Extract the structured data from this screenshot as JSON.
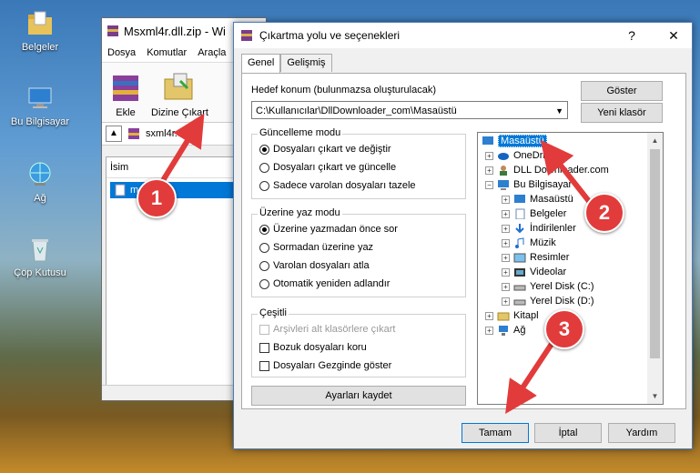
{
  "desktop": {
    "icons": [
      {
        "label": "Belgeler"
      },
      {
        "label": "Bu Bilgisayar"
      },
      {
        "label": "Ağ"
      },
      {
        "label": "Çöp Kutusu"
      }
    ]
  },
  "bg_window": {
    "title": "Msxml4r.dll.zip - Wi",
    "menu": [
      "Dosya",
      "Komutlar",
      "Araçla"
    ],
    "toolbar": {
      "add_label": "Ekle",
      "extract_label": "Dizine Çıkart"
    },
    "address": "sxml4r.dll",
    "column_name": "İsim",
    "file_item": "m          r.dll"
  },
  "dialog": {
    "title": "Çıkartma yolu ve seçenekleri",
    "help_glyph": "?",
    "close_glyph": "✕",
    "tabs": [
      "Genel",
      "Gelişmiş"
    ],
    "dest_label": "Hedef konum (bulunmazsa oluşturulacak)",
    "dest_value": "C:\\Kullanıcılar\\DllDownloader_com\\Masaüstü",
    "show_btn": "Göster",
    "new_folder_btn": "Yeni klasör",
    "update_group": {
      "title": "Güncelleme modu",
      "options": [
        "Dosyaları çıkart ve değiştir",
        "Dosyaları çıkart ve güncelle",
        "Sadece varolan dosyaları tazele"
      ],
      "selected": 0
    },
    "overwrite_group": {
      "title": "Üzerine yaz modu",
      "options": [
        "Üzerine yazmadan önce sor",
        "Sormadan üzerine yaz",
        "Varolan dosyaları atla",
        "Otomatik yeniden adlandır"
      ],
      "selected": 0
    },
    "misc_group": {
      "title": "Çeşitli",
      "options": [
        "Arşivleri alt klasörlere çıkart",
        "Bozuk dosyaları koru",
        "Dosyaları Gezginde göster"
      ]
    },
    "save_btn": "Ayarları kaydet",
    "tree": [
      {
        "label": "Masaüstü",
        "icon": "desktop-icon"
      },
      {
        "label": "OneDri",
        "icon": "cloud-icon"
      },
      {
        "label": "DLL Downloader.com",
        "icon": "user-icon"
      },
      {
        "label": "Bu Bilgisayar",
        "icon": "computer-icon"
      },
      {
        "label": "Masaüstü",
        "icon": "desktop-icon"
      },
      {
        "label": "Belgeler",
        "icon": "documents-icon"
      },
      {
        "label": "İndirilenler",
        "icon": "download-icon"
      },
      {
        "label": "Müzik",
        "icon": "music-icon"
      },
      {
        "label": "Resimler",
        "icon": "pictures-icon"
      },
      {
        "label": "Videolar",
        "icon": "videos-icon"
      },
      {
        "label": "Yerel Disk (C:)",
        "icon": "disk-icon"
      },
      {
        "label": "Yerel Disk (D:)",
        "icon": "disk-icon"
      },
      {
        "label": "Kitapl",
        "icon": "library-icon"
      },
      {
        "label": "Ağ",
        "icon": "network-icon"
      }
    ],
    "ok_btn": "Tamam",
    "cancel_btn": "İptal",
    "help_btn": "Yardım"
  },
  "callouts": [
    "1",
    "2",
    "3"
  ],
  "colors": {
    "accent": "#0078d7",
    "callout": "#e23b3b"
  }
}
